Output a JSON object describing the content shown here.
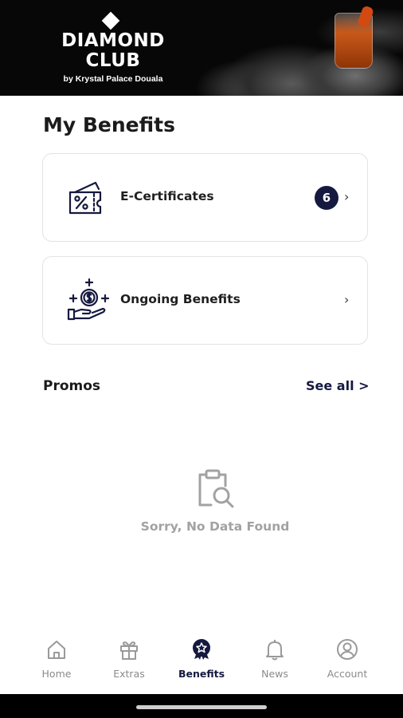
{
  "brand": {
    "name_line1": "DIAMOND",
    "name_line2": "CLUB",
    "subtitle": "by Krystal Palace Douala"
  },
  "page": {
    "title": "My Benefits"
  },
  "cards": {
    "ecertificates": {
      "label": "E-Certificates",
      "badge": "6",
      "icon": "coupon-percent-icon",
      "chevron": "›"
    },
    "ongoing": {
      "label": "Ongoing Benefits",
      "icon": "hand-coin-plus-icon",
      "chevron": "›"
    }
  },
  "promos": {
    "title": "Promos",
    "see_all": "See all >",
    "empty_icon": "clipboard-search-icon",
    "empty_text": "Sorry, No Data Found"
  },
  "nav": {
    "items": [
      {
        "label": "Home",
        "icon": "home-icon",
        "active": false
      },
      {
        "label": "Extras",
        "icon": "gift-icon",
        "active": false
      },
      {
        "label": "Benefits",
        "icon": "award-badge-icon",
        "active": true
      },
      {
        "label": "News",
        "icon": "bell-icon",
        "active": false
      },
      {
        "label": "Account",
        "icon": "user-circle-icon",
        "active": false
      }
    ]
  },
  "colors": {
    "accent": "#15193f",
    "header_bg": "#070707",
    "muted": "#a2a2a2"
  }
}
